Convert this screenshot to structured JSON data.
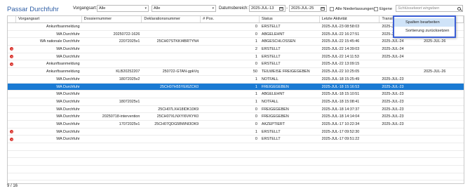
{
  "title": "Passar Durchfuhr",
  "filters": {
    "vorgangsart_label": "Vorgangsart:",
    "vorgangsart_value": "Alle",
    "second_value": "Alle",
    "datum_label": "Datumsbereich:",
    "date_from": "2025-JUL-13",
    "date_sep": "-",
    "date_to": "2025-JUL-25",
    "alle_niederlassungen": "Alle Niederlassungen",
    "eigene": "Eigene",
    "search_placeholder": "Schlüsselwort eingeben"
  },
  "columns": [
    "Vorgangsart",
    "Dossiernummer",
    "Deklarationsnummer",
    "# Pos.",
    "Status",
    "Letzte Aktivität",
    "Transitfrist",
    ""
  ],
  "rows": [
    {
      "err": false,
      "art": "Ankunftsanmeldung",
      "dossier": "",
      "dekl": "",
      "pos": "0",
      "status": "ERSTELLT",
      "activity": "2025-JUL-23 08:58:03",
      "transit": "2025-JUL-23",
      "extra": ""
    },
    {
      "err": false,
      "art": "WA Durchfuhr",
      "dossier": "20250722-1626",
      "dekl": "",
      "pos": "0",
      "status": "ABGELEHNT",
      "activity": "2025-JUL-22 16:27:51",
      "transit": "2025-JUL-24",
      "extra": ""
    },
    {
      "err": false,
      "art": "WA nationale Durchfuhr",
      "dossier": "22072025v1",
      "dekl": "25CH07STKKI4BRTYN4",
      "pos": "1",
      "status": "ABGESCHLOSSEN",
      "activity": "2025-JUL-22 15:45:46",
      "transit": "2025-JUL-24",
      "extra": "2025-JUL-26"
    },
    {
      "err": true,
      "art": "WA Durchfuhr",
      "dossier": "",
      "dekl": "",
      "pos": "2",
      "status": "ERSTELLT",
      "activity": "2025-JUL-22 14:39:03",
      "transit": "2025-JUL-24",
      "extra": ""
    },
    {
      "err": true,
      "art": "WA Durchfuhr",
      "dossier": "",
      "dekl": "",
      "pos": "1",
      "status": "ERSTELLT",
      "activity": "2025-JUL-22 14:11:53",
      "transit": "2025-JUL-24",
      "extra": ""
    },
    {
      "err": true,
      "art": "Ankunftsanmeldung",
      "dossier": "",
      "dekl": "",
      "pos": "0",
      "status": "ERSTELLT",
      "activity": "2025-JUL-22 13:09:15",
      "transit": "",
      "extra": ""
    },
    {
      "err": false,
      "art": "Ankunftsanmeldung",
      "dossier": "KLB20252207",
      "dekl": "250722-GTAN-gpkVq",
      "pos": "50",
      "status": "TEILWEISE FREIGEGEBEN",
      "activity": "2025-JUL-22 10:25:05",
      "transit": "",
      "extra": "2025-JUL-26"
    },
    {
      "err": false,
      "art": "WA Durchfuhr",
      "dossier": "18072025v2",
      "dekl": "",
      "pos": "1",
      "status": "NOTFALL",
      "activity": "2025-JUL-18 15:25:49",
      "transit": "2025-JUL-23",
      "extra": ""
    },
    {
      "err": false,
      "art": "WA Durchfuhr",
      "dossier": "",
      "dekl": "25CH07H55YEI6ZCK0",
      "pos": "1",
      "status": "FREIGEGEBEN",
      "activity": "2025-JUL-18 15:16:53",
      "transit": "2025-JUL-23",
      "extra": "",
      "selected": true
    },
    {
      "err": false,
      "art": "WA Durchfuhr",
      "dossier": "",
      "dekl": "",
      "pos": "1",
      "status": "ABGELEHNT",
      "activity": "2025-JUL-18 15:10:51",
      "transit": "2025-JUL-23",
      "extra": ""
    },
    {
      "err": false,
      "art": "WA Durchfuhr",
      "dossier": "18072025v1",
      "dekl": "",
      "pos": "1",
      "status": "NOTFALL",
      "activity": "2025-JUL-18 15:08:41",
      "transit": "2025-JUL-23",
      "extra": ""
    },
    {
      "err": false,
      "art": "WA Durchfuhr",
      "dossier": "",
      "dekl": "25CH07LXH18IDK10K9",
      "pos": "0",
      "status": "FREIGEGEBEN",
      "activity": "2025-JUL-18 14:37:37",
      "transit": "2025-JUL-23",
      "extra": ""
    },
    {
      "err": false,
      "art": "WA Durchfuhr",
      "dossier": "20250718-intervention",
      "dekl": "25CH07XLNXYI6VKYK0",
      "pos": "0",
      "status": "FREIGEGEBEN",
      "activity": "2025-JUL-18 14:14:04",
      "transit": "2025-JUL-23",
      "extra": ""
    },
    {
      "err": false,
      "art": "WA Durchfuhr",
      "dossier": "17072025v1",
      "dekl": "25CH07QDG5BWNI3OK9",
      "pos": "0",
      "status": "AKZEPTIERT",
      "activity": "2025-JUL-17 10:22:34",
      "transit": "2025-JUL-23",
      "extra": ""
    },
    {
      "err": true,
      "art": "WA Durchfuhr",
      "dossier": "",
      "dekl": "",
      "pos": "1",
      "status": "ERSTELLT",
      "activity": "2025-JUL-17 09:52:30",
      "transit": "",
      "extra": ""
    },
    {
      "err": true,
      "art": "WA Durchfuhr",
      "dossier": "",
      "dekl": "",
      "pos": "0",
      "status": "ERSTELLT",
      "activity": "2025-JUL-17 09:51:22",
      "transit": "",
      "extra": ""
    }
  ],
  "menu": {
    "item1": "Spalten bearbeiten",
    "item2": "Sortierung zurücksetzen"
  },
  "footer": "9 / 16"
}
